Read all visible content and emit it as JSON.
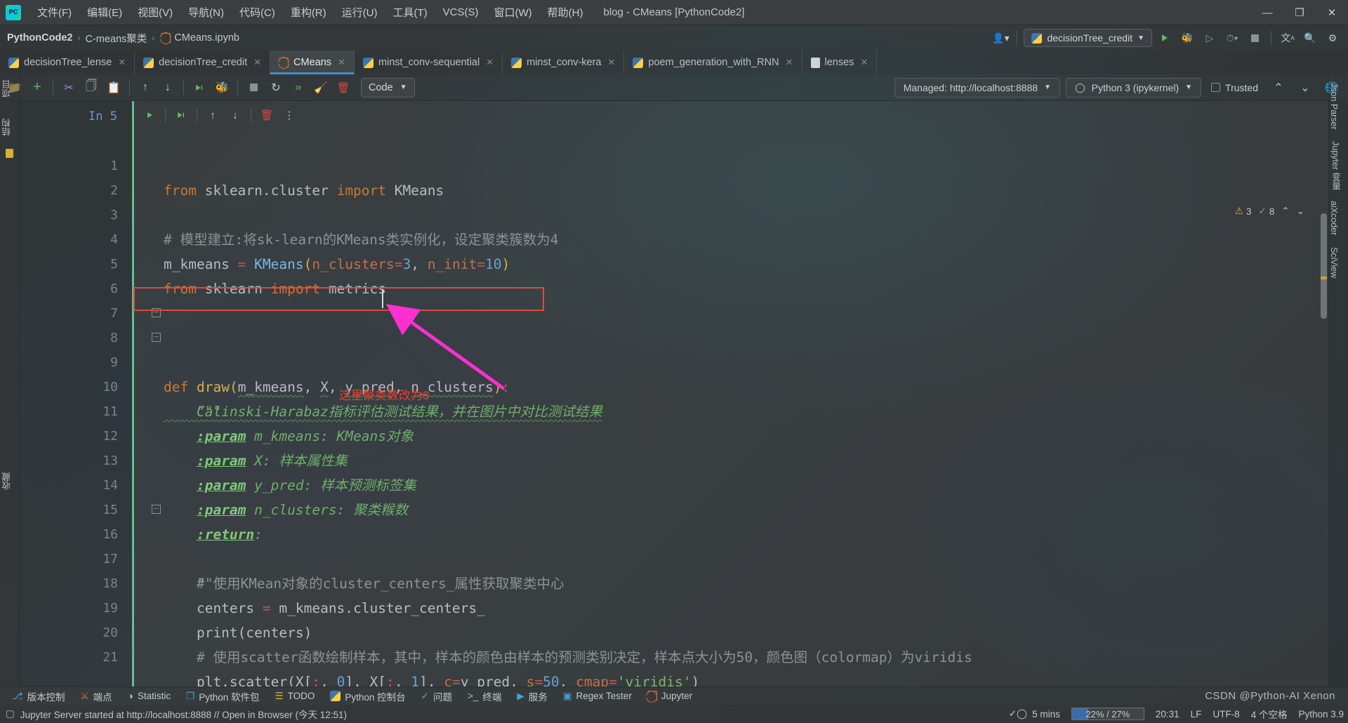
{
  "window": {
    "title": "blog - CMeans [PythonCode2]",
    "logo_text": "PC",
    "minimize": "—",
    "maximize": "❐",
    "close": "✕"
  },
  "menubar": {
    "items": [
      {
        "label": "文件(F)",
        "name": "menu-file"
      },
      {
        "label": "编辑(E)",
        "name": "menu-edit"
      },
      {
        "label": "视图(V)",
        "name": "menu-view"
      },
      {
        "label": "导航(N)",
        "name": "menu-navigate"
      },
      {
        "label": "代码(C)",
        "name": "menu-code"
      },
      {
        "label": "重构(R)",
        "name": "menu-refactor"
      },
      {
        "label": "运行(U)",
        "name": "menu-run"
      },
      {
        "label": "工具(T)",
        "name": "menu-tools"
      },
      {
        "label": "VCS(S)",
        "name": "menu-vcs"
      },
      {
        "label": "窗口(W)",
        "name": "menu-window"
      },
      {
        "label": "帮助(H)",
        "name": "menu-help"
      }
    ]
  },
  "breadcrumb": {
    "project": "PythonCode2",
    "folder": "C-means聚类",
    "file": "CMeans.ipynb",
    "separator": "›"
  },
  "navbar": {
    "run_config": "decisionTree_credit",
    "run_icon": "run-icon",
    "debug_icon": "debug-icon",
    "coverage_icon": "coverage-icon",
    "profile_icon": "profile-icon",
    "stop_icon": "stop-icon",
    "translate_icon": "translate-icon",
    "search_icon": "search-icon",
    "settings_icon": "settings-icon",
    "user_icon": "user-icon"
  },
  "editor_tabs": [
    {
      "label": "decisionTree_lense",
      "icon": "python-file-icon",
      "active": false
    },
    {
      "label": "decisionTree_credit",
      "icon": "python-file-icon",
      "active": false
    },
    {
      "label": "CMeans",
      "icon": "jupyter-notebook-icon",
      "active": true
    },
    {
      "label": "minst_conv-sequential",
      "icon": "python-file-icon",
      "active": false
    },
    {
      "label": "minst_conv-kera",
      "icon": "python-file-icon",
      "active": false
    },
    {
      "label": "poem_generation_with_RNN",
      "icon": "python-file-icon",
      "active": false
    },
    {
      "label": "lenses",
      "icon": "text-file-icon",
      "active": false
    }
  ],
  "notebook_toolbar": {
    "cell_type": "Code",
    "server": "Managed: http://localhost:8888",
    "kernel": "Python 3 (ipykernel)",
    "trusted": "Trusted",
    "icons": [
      "open-folder-icon",
      "add-cell-icon",
      "cut-icon",
      "copy-icon",
      "paste-icon",
      "move-cell-up-icon",
      "move-cell-down-icon",
      "run-cell-icon",
      "debug-cell-icon",
      "interrupt-kernel-icon",
      "restart-kernel-icon",
      "run-all-icon",
      "clear-outputs-icon",
      "delete-cell-icon"
    ]
  },
  "inspections": {
    "warnings": "3",
    "weak_warnings": "8",
    "up_arrow": "⌃",
    "down_arrow": "⌄"
  },
  "cell": {
    "prompt": "In 5",
    "toolbar_icons": [
      "run-cell-icon",
      "run-cell-and-select-icon",
      "move-up-icon",
      "move-down-icon",
      "delete-cell-icon",
      "more-options-icon"
    ]
  },
  "code_lines": [
    {
      "n": "1",
      "text": "from sklearn.cluster import KMeans"
    },
    {
      "n": "2",
      "text": ""
    },
    {
      "n": "3",
      "text": "# 模型建立:将sk-learn的KMeans类实例化，设定聚类簇数为4"
    },
    {
      "n": "4",
      "text": "m_kmeans = KMeans(n_clusters=3, n_init=10)"
    },
    {
      "n": "5",
      "text": "from sklearn import metrics"
    },
    {
      "n": "6",
      "text": ""
    },
    {
      "n": "7",
      "text": ""
    },
    {
      "n": "8",
      "text": "def draw(m_kmeans, X, y_pred, n_clusters):"
    },
    {
      "n": "9",
      "text": "    \"\"\""
    },
    {
      "n": "10",
      "text": "    Calinski-Harabaz指标评估测试结果，并在图片中对比测试结果"
    },
    {
      "n": "11",
      "text": "    :param m_kmeans: KMeans对象"
    },
    {
      "n": "12",
      "text": "    :param X: 样本属性集"
    },
    {
      "n": "13",
      "text": "    :param y_pred: 样本预测标签集"
    },
    {
      "n": "14",
      "text": "    :param n_clusters: 聚类簇数"
    },
    {
      "n": "15",
      "text": "    :return:"
    },
    {
      "n": "16",
      "text": "    \"\"\""
    },
    {
      "n": "17",
      "text": "    # 使用KMean对象的cluster_centers_属性获取聚类中心"
    },
    {
      "n": "18",
      "text": "    centers = m_kmeans.cluster_centers_"
    },
    {
      "n": "19",
      "text": "    print(centers)"
    },
    {
      "n": "20",
      "text": "    # 使用scatter函数绘制样本，其中，样本的颜色由样本的预测类别决定，样本点大小为50，颜色图（colormap）为viridis"
    },
    {
      "n": "21",
      "text": "    plt.scatter(X[:, 0], X[:, 1], c=y_pred, s=50, cmap='viridis')"
    }
  ],
  "annotation": {
    "text": "这里聚类数改为3",
    "arrow_color": "#ff2fd0",
    "box_color": "#e04a3a"
  },
  "left_stripe": [
    {
      "label": "项目",
      "name": "tool-project"
    },
    {
      "label": "结构",
      "name": "tool-structure"
    },
    {
      "label": "收藏",
      "name": "tool-bookmarks"
    }
  ],
  "right_stripe": [
    {
      "label": "Json Parser",
      "name": "tool-json-parser"
    },
    {
      "label": "Jupyter 变量",
      "name": "tool-jupyter-variables"
    },
    {
      "label": "aiXcoder",
      "name": "tool-aixcoder"
    },
    {
      "label": "SciView",
      "name": "tool-sciview"
    }
  ],
  "bottom_tools": [
    {
      "label": "版本控制",
      "icon": "branch-icon",
      "color": "#4a9ed8"
    },
    {
      "label": "端点",
      "icon": "endpoints-icon",
      "color": "#d47a3a"
    },
    {
      "label": "Statistic",
      "icon": "statistic-icon",
      "color": "#b8bcbe"
    },
    {
      "label": "Python 软件包",
      "icon": "packages-icon",
      "color": "#4a9ed8"
    },
    {
      "label": "TODO",
      "icon": "todo-icon",
      "color": "#d4b13a"
    },
    {
      "label": "Python 控制台",
      "icon": "python-console-icon",
      "color": "#ffd040"
    },
    {
      "label": "问题",
      "icon": "problems-icon",
      "color": "#5fb95f"
    },
    {
      "label": "终端",
      "icon": "terminal-icon",
      "color": "#b8bcbe"
    },
    {
      "label": "服务",
      "icon": "services-icon",
      "color": "#4a9ed8"
    },
    {
      "label": "Regex Tester",
      "icon": "regex-tester-icon",
      "color": "#4a9ed8"
    },
    {
      "label": "Jupyter",
      "icon": "jupyter-icon",
      "color": "#d96c2c"
    }
  ],
  "statusbar": {
    "message": "Jupyter Server started at http://localhost:8888 // Open in Browser (今天 12:51)",
    "elapsed": "5 mins",
    "memory": "22% / 27%",
    "memory_fill_pct": 23,
    "time": "20:31",
    "line_sep": "LF",
    "encoding": "UTF-8",
    "indent": "4 个空格",
    "interpreter": "Python 3.9",
    "watermark": "CSDN @Python-AI Xenon"
  }
}
